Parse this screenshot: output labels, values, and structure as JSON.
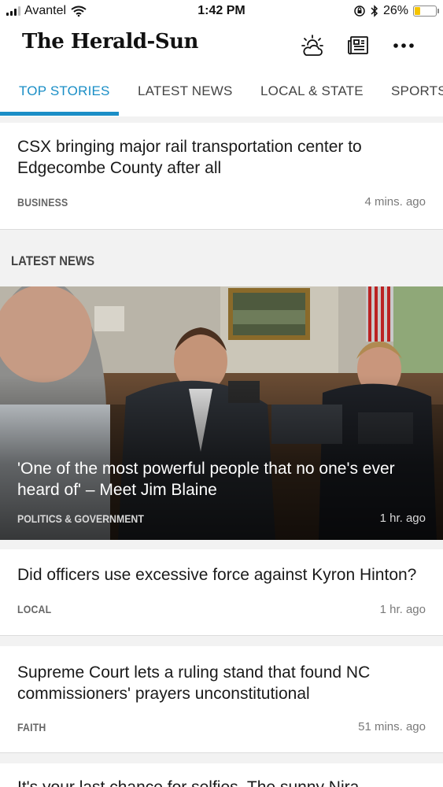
{
  "status_bar": {
    "carrier": "Avantel",
    "time": "1:42 PM",
    "battery": "26%",
    "battery_level": 0.26,
    "battery_color": "#f5c400"
  },
  "header": {
    "logo": "The Herald-Sun",
    "icons": [
      "weather-icon",
      "newspaper-icon",
      "more-icon"
    ]
  },
  "tabs": [
    {
      "label": "TOP STORIES",
      "active": true
    },
    {
      "label": "LATEST NEWS",
      "active": false
    },
    {
      "label": "LOCAL & STATE",
      "active": false
    },
    {
      "label": "SPORTS",
      "active": false
    }
  ],
  "accent_color": "#1a8ec6",
  "top_story": {
    "headline": "CSX bringing major rail transportation center to Edgecombe County after all",
    "section": "BUSINESS",
    "time": "4 mins. ago"
  },
  "latest_news": {
    "heading": "LATEST NEWS",
    "hero": {
      "headline": "'One of the most powerful people that no one's ever heard of' – Meet Jim Blaine",
      "section": "POLITICS & GOVERNMENT",
      "time": "1 hr. ago"
    },
    "items": [
      {
        "headline": "Did officers use excessive force against Kyron Hinton?",
        "section": "LOCAL",
        "time": "1 hr. ago"
      },
      {
        "headline": "Supreme Court lets a ruling stand that found NC commissioners'  prayers unconstitutional",
        "section": "FAITH",
        "time": "51 mins. ago"
      },
      {
        "headline": "It's your last chance for selfies. The sunny Nira..."
      }
    ]
  }
}
